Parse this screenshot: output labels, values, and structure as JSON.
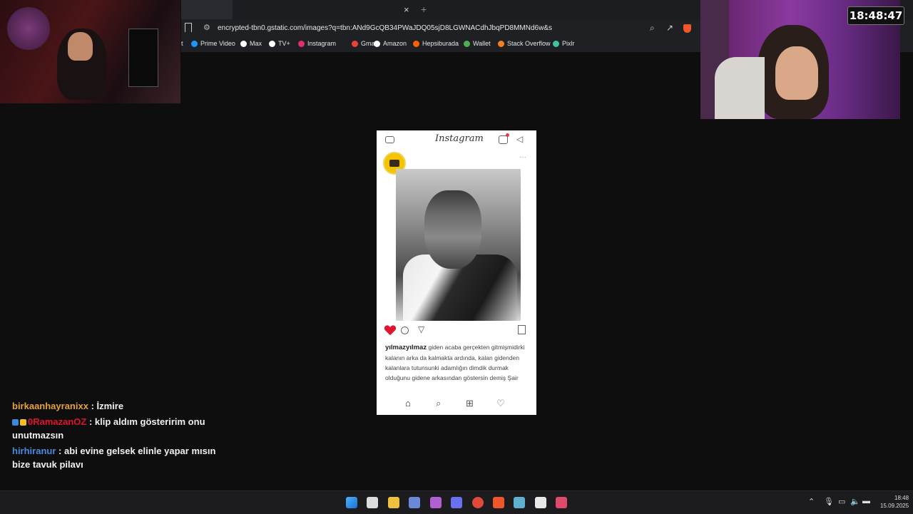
{
  "browser": {
    "tab_close_glyph": "×",
    "tab_new_glyph": "+",
    "url": "encrypted-tbn0.gstatic.com/images?q=tbn:ANd9GcQB34PWaJDQ05sjD8LGWNACdhJbqPD8MMNd6w&s",
    "bookmarks": [
      {
        "label": "t",
        "icon": "bookmark-fragment",
        "color": "#888888"
      },
      {
        "label": "Prime Video",
        "icon": "prime-video-icon",
        "color": "#1a98ff"
      },
      {
        "label": "Max",
        "icon": "max-icon",
        "color": "#ffffff"
      },
      {
        "label": "TV+",
        "icon": "tv-plus-icon",
        "color": "#ffffff"
      },
      {
        "label": "Instagram",
        "icon": "instagram-icon",
        "color": "#e1306c"
      },
      {
        "label": "Gmail",
        "icon": "gmail-icon",
        "color": "#ea4335"
      },
      {
        "label": "Amazon",
        "icon": "amazon-icon",
        "color": "#ffffff"
      },
      {
        "label": "Hepsiburada",
        "icon": "hepsiburada-icon",
        "color": "#ff6000"
      },
      {
        "label": "Wallet",
        "icon": "wallet-icon",
        "color": "#4caf50"
      },
      {
        "label": "Stack Overflow",
        "icon": "stackoverflow-icon",
        "color": "#f48024"
      },
      {
        "label": "Pixlr",
        "icon": "pixlr-icon",
        "color": "#3ec4a0"
      }
    ]
  },
  "overlay": {
    "clock": "18:48:47"
  },
  "instagram": {
    "logo": "Instagram",
    "username": "yılmazyılmaz",
    "caption": "giden acaba gerçekten gitmişmidirki kalanın arka da kalmakta ardında, kalan gidenden kalanlara tutunsunki adamlığın dimdik durmak olduğunu gidene arkasından göstersin demiş Şair",
    "liked": true,
    "heart_color": "#e0142a"
  },
  "chat": [
    {
      "user": "birkaanhayranixx",
      "text": "İzmire",
      "user_color": "#e8a13a",
      "badges": []
    },
    {
      "user": "0RamazanOZ",
      "text": "klip aldım gösteririm onu unutmazsın",
      "user_color": "#e0142a",
      "badges": [
        "#3a8ad8",
        "#f0c020"
      ]
    },
    {
      "user": "hirhiranur",
      "text": "abi evine gelsek elinle yapar mısın bize tavuk pilavı",
      "user_color": "#4a8ae0",
      "badges": []
    }
  ],
  "chat_separator": " : ",
  "taskbar": {
    "icons": [
      "windows-start-icon",
      "search-icon",
      "file-explorer-icon",
      "store-icon",
      "app-purple-icon",
      "discord-icon",
      "chrome-icon",
      "brave-icon",
      "settings-icon",
      "obs-icon",
      "streamlabs-icon"
    ],
    "time": "18:48",
    "date": "15.09.2025"
  }
}
